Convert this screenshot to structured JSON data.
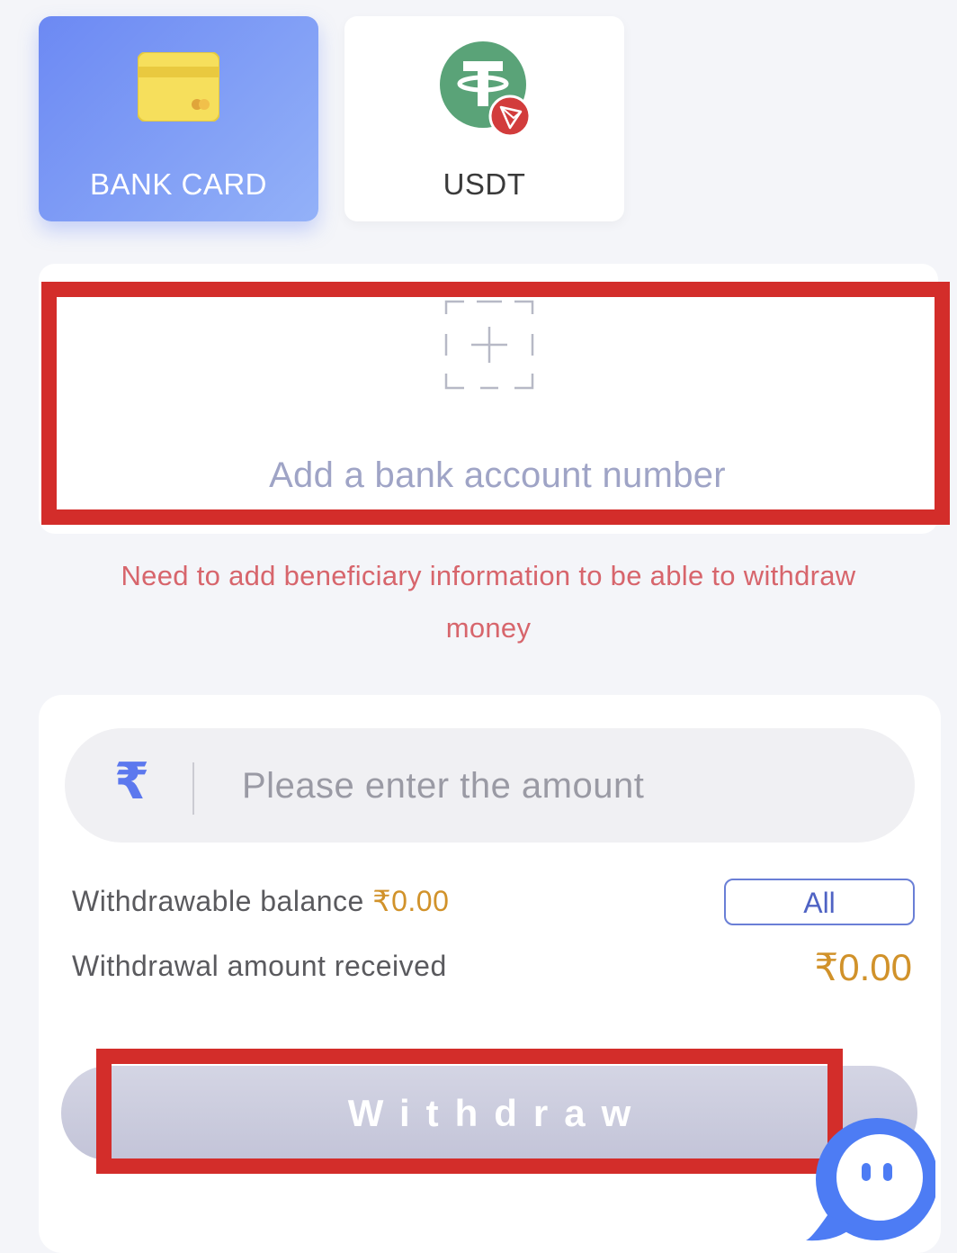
{
  "methods": {
    "bank_card_label": "BANK CARD",
    "usdt_label": "USDT"
  },
  "bank_account": {
    "add_label": "Add a bank account number",
    "warning_line1": "Need to add beneficiary information to be able to withdraw",
    "warning_line2": "money"
  },
  "amount": {
    "currency_symbol": "₹",
    "placeholder": "Please enter the amount",
    "withdrawable_label": "Withdrawable balance",
    "withdrawable_value": "₹0.00",
    "all_button": "All",
    "received_label": "Withdrawal amount received",
    "received_value": "₹0.00"
  },
  "withdraw_button": "Withdraw",
  "icons": {
    "bank_card": "credit-card-icon",
    "usdt": "usdt-tron-icon",
    "add": "add-plus-icon",
    "chat": "chat-support-icon"
  },
  "colors": {
    "accent": "#6c89f3",
    "highlight": "#d32d2a",
    "warning": "#d7656c",
    "amount": "#d1922a"
  }
}
